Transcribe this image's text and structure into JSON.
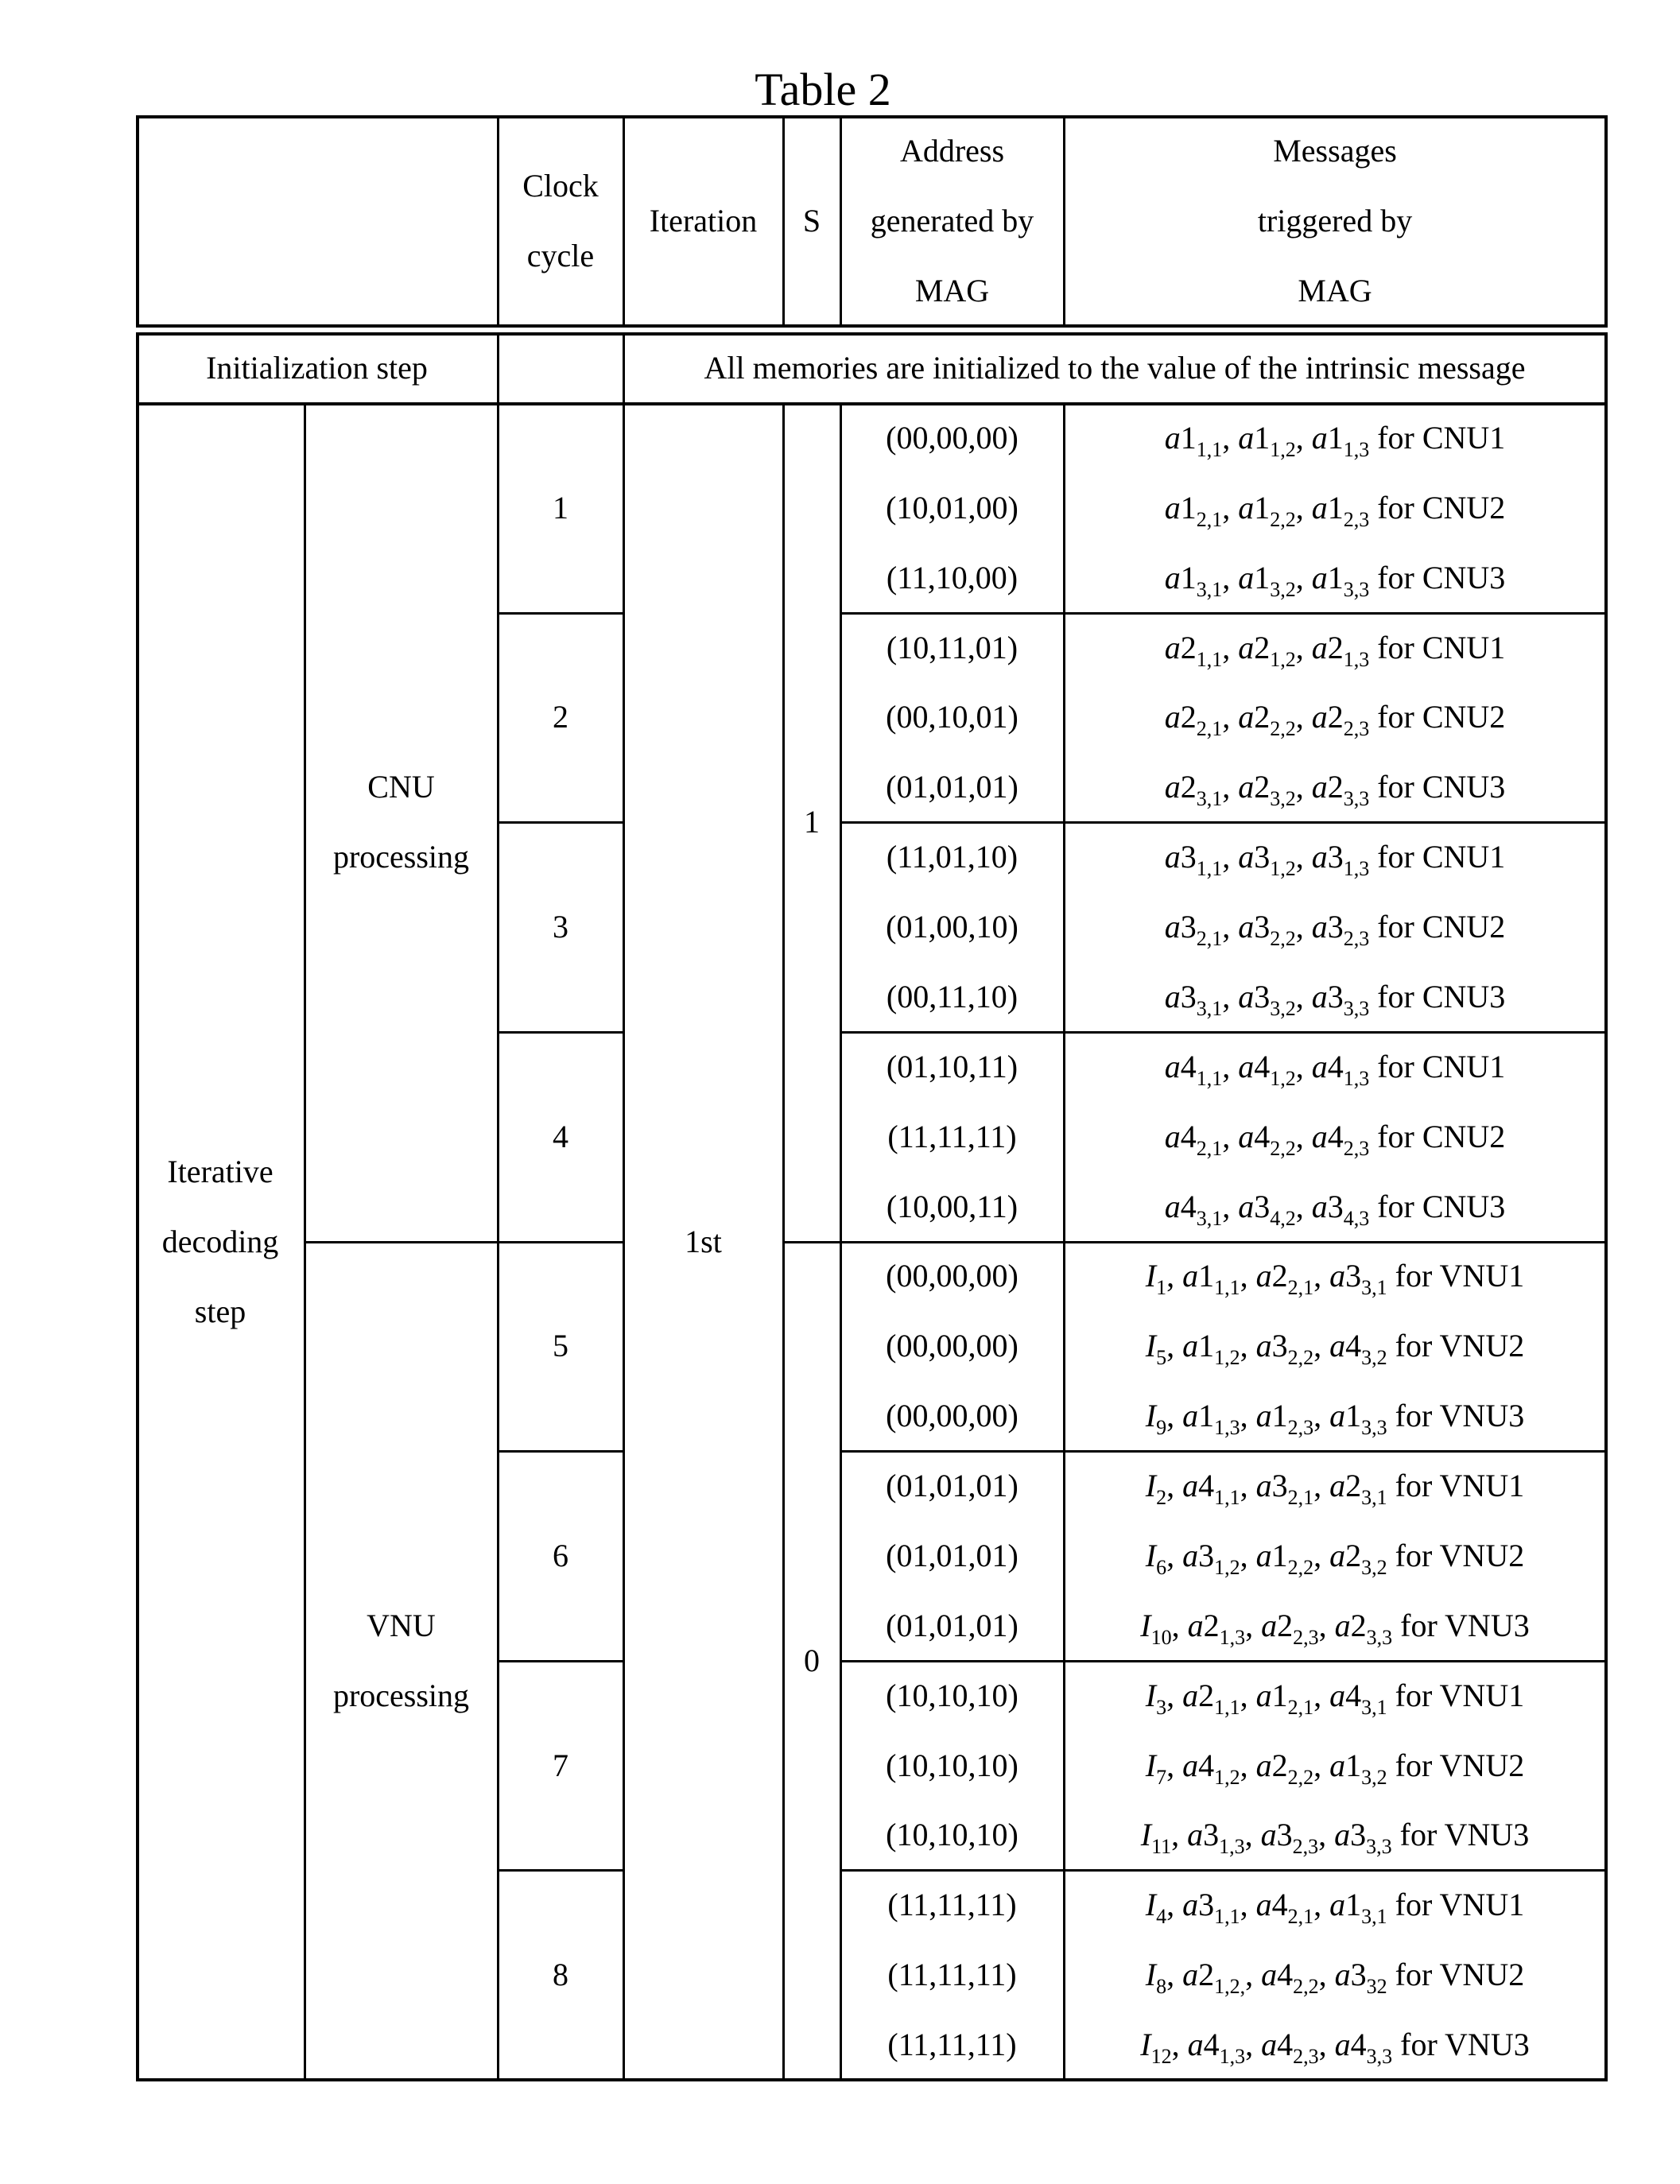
{
  "title": "Table 2",
  "header": {
    "col_blank": "",
    "clock_cycle": [
      "Clock",
      "cycle"
    ],
    "iteration": "Iteration",
    "s": "S",
    "address": [
      "Address",
      "generated by",
      "MAG"
    ],
    "messages": [
      "Messages",
      "triggered by",
      "MAG"
    ]
  },
  "init_row": {
    "label": "Initialization step",
    "clock": "",
    "text": "All memories are initialized to the value of the intrinsic message"
  },
  "body": {
    "step_label": [
      "Iterative",
      "decoding",
      "step"
    ],
    "iteration": "1st",
    "phases": [
      {
        "label": [
          "CNU",
          "processing"
        ],
        "s": "1"
      },
      {
        "label": [
          "VNU",
          "processing"
        ],
        "s": "0"
      }
    ],
    "cycles": [
      {
        "cycle": "1",
        "rows": [
          {
            "address": "(00,00,00)",
            "message": [
              [
                "a1",
                "1,1"
              ],
              [
                "a1",
                "1,2"
              ],
              [
                "a1",
                "1,3"
              ]
            ],
            "unit": "for CNU1"
          },
          {
            "address": "(10,01,00)",
            "message": [
              [
                "a1",
                "2,1"
              ],
              [
                "a1",
                "2,2"
              ],
              [
                "a1",
                "2,3"
              ]
            ],
            "unit": "for CNU2"
          },
          {
            "address": "(11,10,00)",
            "message": [
              [
                "a1",
                "3,1"
              ],
              [
                "a1",
                "3,2"
              ],
              [
                "a1",
                "3,3"
              ]
            ],
            "unit": "for CNU3"
          }
        ]
      },
      {
        "cycle": "2",
        "rows": [
          {
            "address": "(10,11,01)",
            "message": [
              [
                "a2",
                "1,1"
              ],
              [
                "a2",
                "1,2"
              ],
              [
                "a2",
                "1,3"
              ]
            ],
            "unit": "for CNU1"
          },
          {
            "address": "(00,10,01)",
            "message": [
              [
                "a2",
                "2,1"
              ],
              [
                "a2",
                "2,2"
              ],
              [
                "a2",
                "2,3"
              ]
            ],
            "unit": "for CNU2"
          },
          {
            "address": "(01,01,01)",
            "message": [
              [
                "a2",
                "3,1"
              ],
              [
                "a2",
                "3,2"
              ],
              [
                "a2",
                "3,3"
              ]
            ],
            "unit": "for CNU3"
          }
        ]
      },
      {
        "cycle": "3",
        "rows": [
          {
            "address": "(11,01,10)",
            "message": [
              [
                "a3",
                "1,1"
              ],
              [
                "a3",
                "1,2"
              ],
              [
                "a3",
                "1,3"
              ]
            ],
            "unit": "for CNU1"
          },
          {
            "address": "(01,00,10)",
            "message": [
              [
                "a3",
                "2,1"
              ],
              [
                "a3",
                "2,2"
              ],
              [
                "a3",
                "2,3"
              ]
            ],
            "unit": "for CNU2"
          },
          {
            "address": "(00,11,10)",
            "message": [
              [
                "a3",
                "3,1"
              ],
              [
                "a3",
                "3,2"
              ],
              [
                "a3",
                "3,3"
              ]
            ],
            "unit": "for CNU3"
          }
        ]
      },
      {
        "cycle": "4",
        "rows": [
          {
            "address": "(01,10,11)",
            "message": [
              [
                "a4",
                "1,1"
              ],
              [
                "a4",
                "1,2"
              ],
              [
                "a4",
                "1,3"
              ]
            ],
            "unit": "for CNU1"
          },
          {
            "address": "(11,11,11)",
            "message": [
              [
                "a4",
                "2,1"
              ],
              [
                "a4",
                "2,2"
              ],
              [
                "a4",
                "2,3"
              ]
            ],
            "unit": "for CNU2"
          },
          {
            "address": "(10,00,11)",
            "message": [
              [
                "a4",
                "3,1"
              ],
              [
                "a3",
                "4,2"
              ],
              [
                "a3",
                "4,3"
              ]
            ],
            "unit": "for CNU3"
          }
        ]
      },
      {
        "cycle": "5",
        "rows": [
          {
            "address": "(00,00,00)",
            "message": [
              [
                "I",
                "1"
              ],
              [
                "a1",
                "1,1"
              ],
              [
                "a2",
                "2,1"
              ],
              [
                "a3",
                "3,1"
              ]
            ],
            "unit": "for VNU1"
          },
          {
            "address": "(00,00,00)",
            "message": [
              [
                "I",
                "5"
              ],
              [
                "a1",
                "1,2"
              ],
              [
                "a3",
                "2,2"
              ],
              [
                "a4",
                "3,2"
              ]
            ],
            "unit": "for VNU2"
          },
          {
            "address": "(00,00,00)",
            "message": [
              [
                "I",
                "9"
              ],
              [
                "a1",
                "1,3"
              ],
              [
                "a1",
                "2,3"
              ],
              [
                "a1",
                "3,3"
              ]
            ],
            "unit": "for VNU3"
          }
        ]
      },
      {
        "cycle": "6",
        "rows": [
          {
            "address": "(01,01,01)",
            "message": [
              [
                "I",
                "2"
              ],
              [
                "a4",
                "1,1"
              ],
              [
                "a3",
                "2,1"
              ],
              [
                "a2",
                "3,1"
              ]
            ],
            "unit": "for VNU1"
          },
          {
            "address": "(01,01,01)",
            "message": [
              [
                "I",
                "6"
              ],
              [
                "a3",
                "1,2"
              ],
              [
                "a1",
                "2,2"
              ],
              [
                "a2",
                "3,2"
              ]
            ],
            "unit": "for VNU2"
          },
          {
            "address": "(01,01,01)",
            "message": [
              [
                "I",
                "10"
              ],
              [
                "a2",
                "1,3"
              ],
              [
                "a2",
                "2,3"
              ],
              [
                "a2",
                "3,3"
              ]
            ],
            "unit": "for VNU3"
          }
        ]
      },
      {
        "cycle": "7",
        "rows": [
          {
            "address": "(10,10,10)",
            "message": [
              [
                "I",
                "3"
              ],
              [
                "a2",
                "1,1"
              ],
              [
                "a1",
                "2,1"
              ],
              [
                "a4",
                "3,1"
              ]
            ],
            "unit": "for VNU1"
          },
          {
            "address": "(10,10,10)",
            "message": [
              [
                "I",
                "7"
              ],
              [
                "a4",
                "1,2"
              ],
              [
                "a2",
                "2,2"
              ],
              [
                "a1",
                "3,2"
              ]
            ],
            "unit": "for VNU2"
          },
          {
            "address": "(10,10,10)",
            "message": [
              [
                "I",
                "11"
              ],
              [
                "a3",
                "1,3"
              ],
              [
                "a3",
                "2,3"
              ],
              [
                "a3",
                "3,3"
              ]
            ],
            "unit": "for VNU3"
          }
        ]
      },
      {
        "cycle": "8",
        "rows": [
          {
            "address": "(11,11,11)",
            "message": [
              [
                "I",
                "4"
              ],
              [
                "a3",
                "1,1"
              ],
              [
                "a4",
                "2,1"
              ],
              [
                "a1",
                "3,1"
              ]
            ],
            "unit": "for VNU1"
          },
          {
            "address": "(11,11,11)",
            "message": [
              [
                "I",
                "8"
              ],
              [
                "a2",
                "1,2,"
              ],
              [
                "a4",
                "2,2"
              ],
              [
                "a3",
                "32"
              ]
            ],
            "unit": "for VNU2"
          },
          {
            "address": "(11,11,11)",
            "message": [
              [
                "I",
                "12"
              ],
              [
                "a4",
                "1,3"
              ],
              [
                "a4",
                "2,3"
              ],
              [
                "a4",
                "3,3"
              ]
            ],
            "unit": "for VNU3"
          }
        ]
      }
    ]
  }
}
